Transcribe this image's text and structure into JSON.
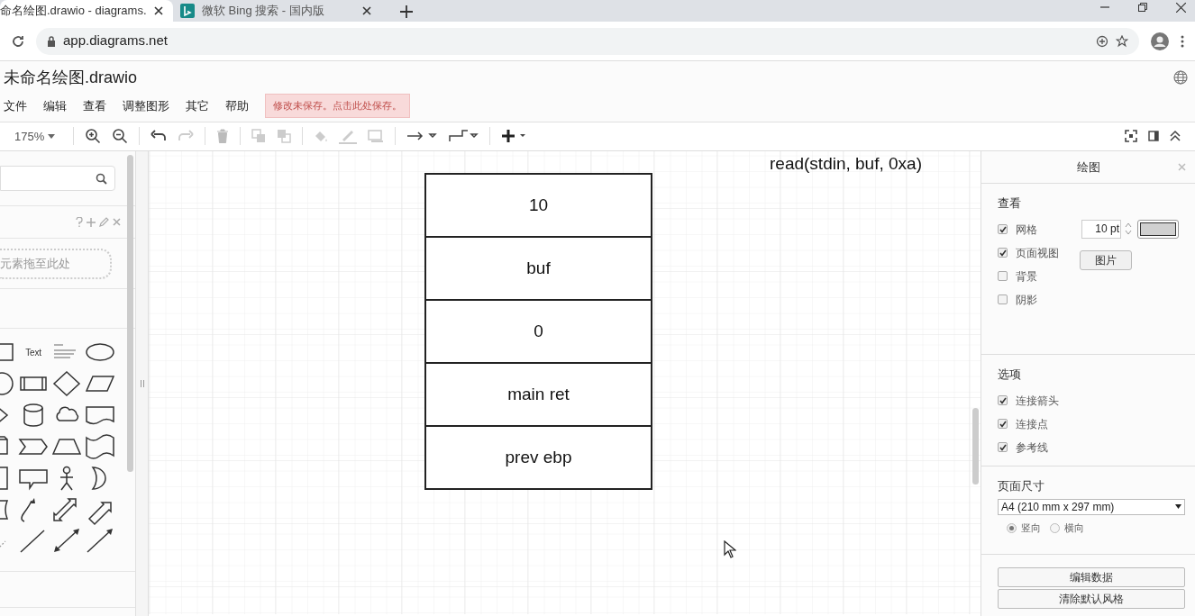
{
  "browser": {
    "tabs": [
      {
        "title": "命名绘图.drawio - diagrams.",
        "selected": true
      },
      {
        "title": "微软 Bing 搜索 - 国内版",
        "selected": false
      }
    ],
    "url": "app.diagrams.net"
  },
  "app": {
    "title": "未命名绘图.drawio",
    "menu": [
      "文件",
      "编辑",
      "查看",
      "调整图形",
      "其它",
      "帮助"
    ],
    "save_notice": "修改未保存。点击此处保存。",
    "zoom": "175%"
  },
  "sidebar": {
    "drop_hint": "元素拖至此处",
    "shape_text": "Text"
  },
  "canvas": {
    "stack": [
      "10",
      "buf",
      "0",
      "main ret",
      "prev ebp"
    ],
    "label": "read(stdin, buf, 0xa)"
  },
  "format_panel": {
    "title": "绘图",
    "sections": [
      {
        "title": "查看",
        "options": [
          {
            "label": "网格",
            "checked": true
          },
          {
            "label": "页面视图",
            "checked": true
          },
          {
            "label": "背景",
            "checked": false
          },
          {
            "label": "阴影",
            "checked": false
          }
        ]
      },
      {
        "title": "选项",
        "options": [
          {
            "label": "连接箭头",
            "checked": true
          },
          {
            "label": "连接点",
            "checked": true
          },
          {
            "label": "参考线",
            "checked": true
          }
        ]
      }
    ],
    "grid_size": "10 pt",
    "image_button": "图片",
    "page_size_title": "页面尺寸",
    "page_size": "A4 (210 mm x 297 mm)",
    "orientation": [
      {
        "label": "竖向",
        "selected": true
      },
      {
        "label": "横向",
        "selected": false
      }
    ],
    "buttons": [
      "编辑数据",
      "清除默认风格"
    ]
  }
}
